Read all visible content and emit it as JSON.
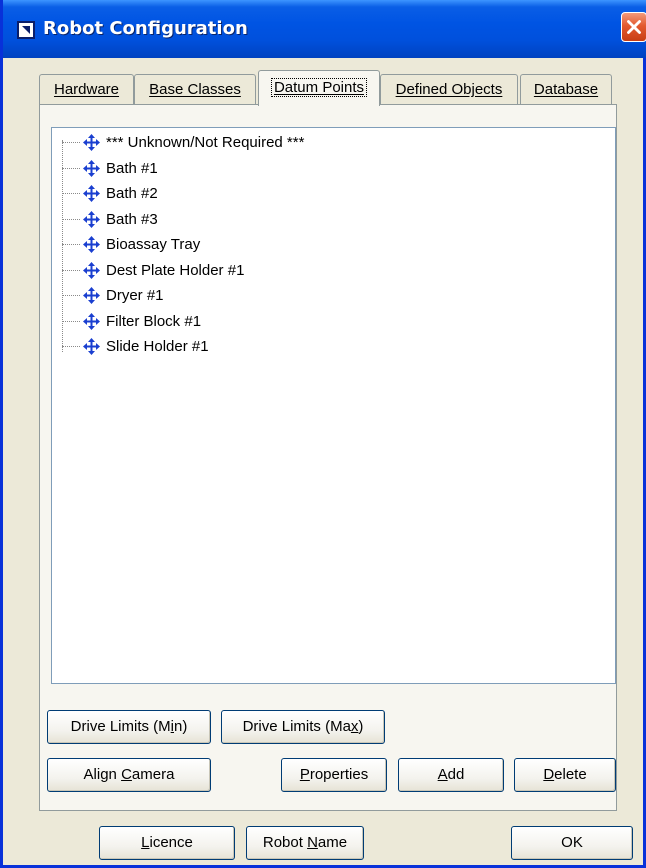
{
  "window": {
    "title": "Robot Configuration"
  },
  "tabs": [
    {
      "label": "Hardware",
      "active": false
    },
    {
      "label": "Base Classes",
      "active": false
    },
    {
      "label": "Datum Points",
      "active": true
    },
    {
      "label": "Defined Objects",
      "active": false
    },
    {
      "label": "Database",
      "active": false
    }
  ],
  "datum_points": [
    "*** Unknown/Not Required ***",
    "Bath #1",
    "Bath #2",
    "Bath #3",
    "Bioassay Tray",
    "Dest Plate Holder #1",
    "Dryer #1",
    "Filter Block #1",
    "Slide Holder #1"
  ],
  "buttons": {
    "drive_min": {
      "pre": "Drive Limits (M",
      "key": "i",
      "post": "n)"
    },
    "drive_max": {
      "pre": "Drive Limits (Ma",
      "key": "x",
      "post": ")"
    },
    "align_camera": {
      "pre": "Align ",
      "key": "C",
      "post": "amera"
    },
    "properties": {
      "pre": "",
      "key": "P",
      "post": "roperties"
    },
    "add": {
      "pre": "",
      "key": "A",
      "post": "dd"
    },
    "delete": {
      "pre": "",
      "key": "D",
      "post": "elete"
    },
    "licence": {
      "pre": "",
      "key": "L",
      "post": "icence"
    },
    "robot_name": {
      "pre": "Robot ",
      "key": "N",
      "post": "ame"
    },
    "ok": {
      "pre": "OK",
      "key": "",
      "post": ""
    }
  },
  "icons": {
    "app": "robot-app-icon",
    "close": "close-icon",
    "item": "move-arrows-icon"
  },
  "colors": {
    "titlebar": "#0054e3",
    "close": "#e35a2f",
    "item_icon": "#1a3fd0"
  }
}
